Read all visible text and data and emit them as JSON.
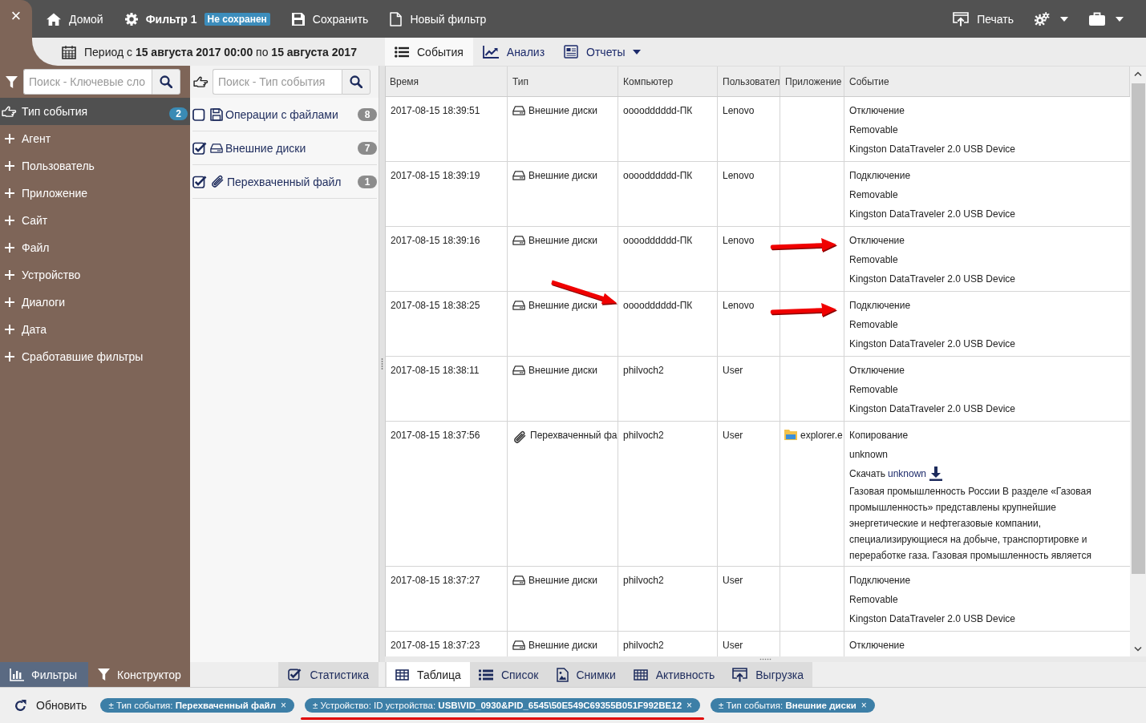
{
  "topbar": {
    "close": "×",
    "home": "Домой",
    "filter": {
      "name": "Фильтр 1",
      "badge": "Не сохранен"
    },
    "actions": [
      "Сохранить",
      "Новый фильтр"
    ],
    "print": "Печать"
  },
  "period": "Период с **15 августа 2017 00:00** по **15 августа 2017**",
  "keyword_search": {
    "placeholder": "Поиск - Ключевые сло"
  },
  "type_search": {
    "placeholder": "Поиск - Тип события"
  },
  "sidebar": {
    "items": [
      {
        "label": "Тип события",
        "selected": true,
        "count": "2"
      },
      {
        "label": "Агент",
        "selected": false
      },
      {
        "label": "Пользователь",
        "selected": false
      },
      {
        "label": "Приложение",
        "selected": false
      },
      {
        "label": "Сайт",
        "selected": false
      },
      {
        "label": "Файл",
        "selected": false
      },
      {
        "label": "Устройство",
        "selected": false
      },
      {
        "label": "Диалоги",
        "selected": false
      },
      {
        "label": "Дата",
        "selected": false
      },
      {
        "label": "Сработавшие фильтры",
        "selected": false
      }
    ]
  },
  "event_types": [
    {
      "kind": "file_operations",
      "label": "Операции с файлами",
      "checked": false,
      "count": "8"
    },
    {
      "kind": "external_disk",
      "label": "Внешние диски",
      "checked": true,
      "count": "7"
    },
    {
      "kind": "intercepted_file",
      "label": "Перехваченный файл",
      "checked": true,
      "count": "1"
    }
  ],
  "view_tabs": [
    {
      "label": "События",
      "selected": true,
      "has_menu": false
    },
    {
      "label": "Анализ",
      "selected": false,
      "has_menu": false
    },
    {
      "label": "Отчеты",
      "selected": false,
      "has_menu": true
    }
  ],
  "table": {
    "columns": [
      "Время",
      "Тип",
      "Компьютер",
      "Пользовател",
      "Приложение",
      "Событие"
    ],
    "rows": [
      {
        "time": "2017-08-15 18:39:51",
        "type": {
          "kind": "external_disk",
          "text": "Внешние диски"
        },
        "computer": "oooodddddd-ПК",
        "user": "Lenovo",
        "event": [
          "Отключение",
          "Removable",
          "Kingston DataTraveler 2.0 USB Device"
        ],
        "event_marked": false,
        "computer_marked": false
      },
      {
        "time": "2017-08-15 18:39:19",
        "type": {
          "kind": "external_disk",
          "text": "Внешние диски"
        },
        "computer": "oooodddddd-ПК",
        "user": "Lenovo",
        "event": [
          "Подключение",
          "Removable",
          "Kingston DataTraveler 2.0 USB Device"
        ],
        "event_marked": false,
        "computer_marked": false
      },
      {
        "time": "2017-08-15 18:39:16",
        "type": {
          "kind": "external_disk",
          "text": "Внешние диски"
        },
        "computer": "oooodddddd-ПК",
        "user": "Lenovo",
        "event": [
          "Отключение",
          "Removable",
          "Kingston DataTraveler 2.0 USB Device"
        ],
        "event_marked": true,
        "computer_marked": false
      },
      {
        "time": "2017-08-15 18:38:25",
        "type": {
          "kind": "external_disk",
          "text": "Внешние диски"
        },
        "computer": "oooodddddd-ПК",
        "user": "Lenovo",
        "event": [
          "Подключение",
          "Removable",
          "Kingston DataTraveler 2.0 USB Device"
        ],
        "event_marked": true,
        "computer_marked": true
      },
      {
        "time": "2017-08-15 18:38:11",
        "type": {
          "kind": "external_disk",
          "text": "Внешние диски"
        },
        "computer": "philvoch2",
        "user": "User",
        "event": [
          "Отключение",
          "Removable",
          "Kingston DataTraveler 2.0 USB Device"
        ],
        "event_marked": false,
        "computer_marked": false
      },
      {
        "time": "2017-08-15 18:37:56",
        "type": {
          "kind": "intercepted_file",
          "text": "Перехваченный фа"
        },
        "computer": "philvoch2",
        "user": "User",
        "app": "explorer.e",
        "event": [
          "Копирование",
          "unknown"
        ],
        "download": {
          "label": "Скачать",
          "link": "unknown"
        },
        "description": "Газовая промышленность России В разделе «Газовая промышленность» представлены крупнейшие энергетические и нефтегазовые компании, специализирующиеся на добыче, транспортировке и переработке газа. Газовая промышленность является",
        "event_marked": false,
        "computer_marked": false
      },
      {
        "time": "2017-08-15 18:37:27",
        "type": {
          "kind": "external_disk",
          "text": "Внешние диски"
        },
        "computer": "philvoch2",
        "user": "User",
        "event": [
          "Подключение",
          "Removable",
          "Kingston DataTraveler 2.0 USB Device"
        ],
        "event_marked": false,
        "computer_marked": false
      },
      {
        "time": "2017-08-15 18:37:23",
        "type": {
          "kind": "external_disk",
          "text": "Внешние диски"
        },
        "computer": "philvoch2",
        "user": "User",
        "event": [
          "Отключение"
        ],
        "event_marked": false,
        "computer_marked": false
      }
    ]
  },
  "bottom_left_tabs": [
    {
      "label": "Фильтры",
      "selected": true
    },
    {
      "label": "Конструктор",
      "selected": false
    }
  ],
  "statistics_button": "Статистика",
  "bottom_tabs": [
    {
      "label": "Таблица",
      "selected": true
    },
    {
      "label": "Список",
      "selected": false
    },
    {
      "label": "Снимки",
      "selected": false
    },
    {
      "label": "Активность",
      "selected": false
    },
    {
      "label": "Выгрузка",
      "selected": false
    }
  ],
  "status_bar": {
    "refresh": "Обновить",
    "tags": [
      {
        "text": "± Тип события: **Перехваченный файл**",
        "remove": "×",
        "underlined": false
      },
      {
        "text": "± Устройство: ID устройства: **USB\\VID_0930&PID_6545\\50E549C69355B051F992BE12**",
        "remove": "×",
        "underlined": true
      },
      {
        "text": "± Тип события: **Внешние диски**",
        "remove": "×",
        "underlined": false
      }
    ]
  }
}
